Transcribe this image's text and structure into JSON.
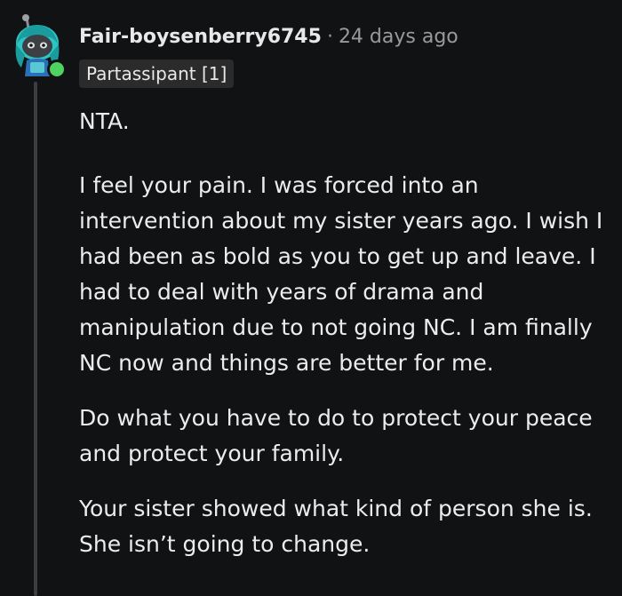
{
  "comment": {
    "username": "Fair-boysenberry6745",
    "separator": "·",
    "timestamp": "24 days ago",
    "flair": "Partassipant [1]",
    "avatar_icon": "snoo-avatar-icon",
    "online_status_color": "#4fd25f",
    "paragraphs": [
      "NTA.",
      "I feel your pain. I was forced into an intervention about my sister years ago. I wish I had been as bold as you to get up and leave. I had to deal with years of drama and manipulation due to not going NC. I am finally NC now and things are better for me.",
      "Do what you have to do to protect your peace and protect your family.",
      "Your sister showed what kind of person she is. She isn’t going to change."
    ]
  }
}
